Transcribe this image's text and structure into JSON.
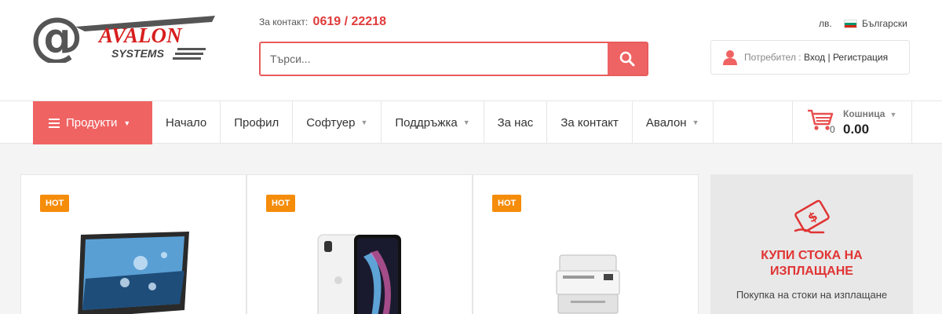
{
  "header": {
    "logo_text": "AVALON",
    "logo_subtext": "SYSTEMS",
    "contact_label": "За контакт:",
    "contact_phone": "0619 / 22218",
    "search_placeholder": "Търси...",
    "currency": "лв.",
    "language": "Български",
    "user_label": "Потребител :",
    "login_label": "Вход",
    "separator": "|",
    "register_label": "Регистрация"
  },
  "nav": {
    "products_label": "Продукти",
    "items": [
      {
        "label": "Начало",
        "dropdown": false
      },
      {
        "label": "Профил",
        "dropdown": false
      },
      {
        "label": "Софтуер",
        "dropdown": true
      },
      {
        "label": "Поддръжка",
        "dropdown": true
      },
      {
        "label": "За нас",
        "dropdown": false
      },
      {
        "label": "За контакт",
        "dropdown": false
      },
      {
        "label": "Авалон",
        "dropdown": true
      }
    ],
    "cart_label": "Кошница",
    "cart_count": "0",
    "cart_total": "0.00"
  },
  "products": [
    {
      "badge": "HOT",
      "image": "monitor"
    },
    {
      "badge": "HOT",
      "image": "smartphone"
    },
    {
      "badge": "HOT",
      "image": "printer"
    }
  ],
  "promo": {
    "icon": "money-hand-icon",
    "title": "КУПИ СТОКА НА ИЗПЛАЩАНЕ",
    "text": "Покупка на стоки на изплащане"
  },
  "colors": {
    "accent": "#f06363",
    "phone": "#e03a3a",
    "hot_badge": "#f58c0a",
    "promo_title": "#e03434"
  }
}
